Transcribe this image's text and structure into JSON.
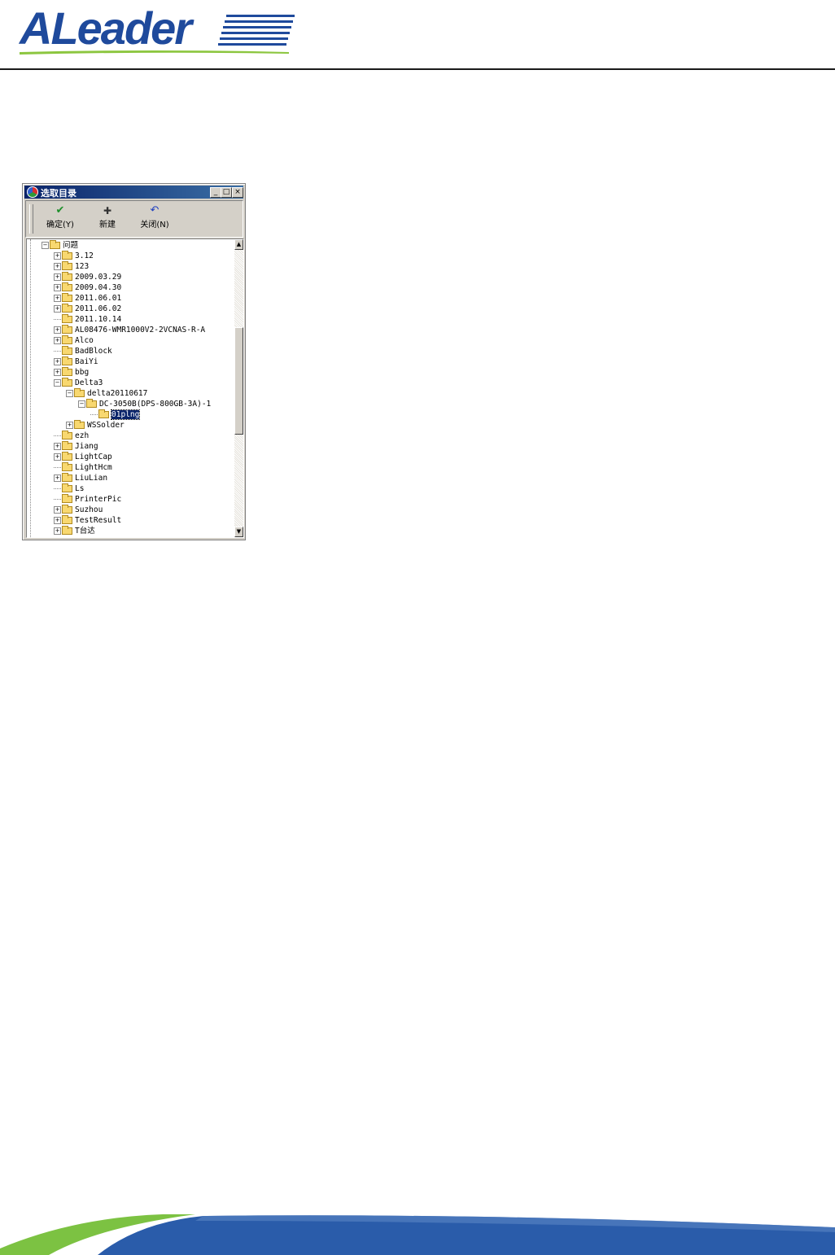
{
  "header": {
    "logo_text": "ALeader",
    "logo_icon": "aleader-logo"
  },
  "dialog": {
    "title": "选取目录",
    "title_icon": "app-icon",
    "window_controls": {
      "minimize": "_",
      "maximize": "□",
      "close": "×"
    },
    "toolbar": {
      "ok_label": "确定(Y)",
      "ok_icon": "checkmark-icon",
      "new_label": "新建",
      "new_icon": "plus-icon",
      "close_label": "关闭(N)",
      "close_icon": "undo-icon"
    },
    "tree": {
      "nodes": [
        {
          "label": "问题",
          "depth": 0,
          "expander": "-"
        },
        {
          "label": "3.12",
          "depth": 1,
          "expander": "+"
        },
        {
          "label": "123",
          "depth": 1,
          "expander": "+"
        },
        {
          "label": "2009.03.29",
          "depth": 1,
          "expander": "+"
        },
        {
          "label": "2009.04.30",
          "depth": 1,
          "expander": "+"
        },
        {
          "label": "2011.06.01",
          "depth": 1,
          "expander": "+"
        },
        {
          "label": "2011.06.02",
          "depth": 1,
          "expander": "+"
        },
        {
          "label": "2011.10.14",
          "depth": 1,
          "expander": ""
        },
        {
          "label": "AL08476-WMR1000V2-2VCNAS-R-A",
          "depth": 1,
          "expander": "+"
        },
        {
          "label": "Alco",
          "depth": 1,
          "expander": "+"
        },
        {
          "label": "BadBlock",
          "depth": 1,
          "expander": ""
        },
        {
          "label": "BaiYi",
          "depth": 1,
          "expander": "+"
        },
        {
          "label": "bbg",
          "depth": 1,
          "expander": "+"
        },
        {
          "label": "Delta3",
          "depth": 1,
          "expander": "-"
        },
        {
          "label": "delta20110617",
          "depth": 2,
          "expander": "-"
        },
        {
          "label": "DC-3050B(DPS-800GB-3A)-1",
          "depth": 3,
          "expander": "-"
        },
        {
          "label": "01plng",
          "depth": 4,
          "expander": "",
          "selected": true
        },
        {
          "label": "WSSolder",
          "depth": 2,
          "expander": "+"
        },
        {
          "label": "ezh",
          "depth": 1,
          "expander": ""
        },
        {
          "label": "Jiang",
          "depth": 1,
          "expander": "+"
        },
        {
          "label": "LightCap",
          "depth": 1,
          "expander": "+"
        },
        {
          "label": "LightHcm",
          "depth": 1,
          "expander": ""
        },
        {
          "label": "LiuLian",
          "depth": 1,
          "expander": "+"
        },
        {
          "label": "Ls",
          "depth": 1,
          "expander": ""
        },
        {
          "label": "PrinterPic",
          "depth": 1,
          "expander": ""
        },
        {
          "label": "Suzhou",
          "depth": 1,
          "expander": "+"
        },
        {
          "label": "TestResult",
          "depth": 1,
          "expander": "+"
        },
        {
          "label": "T台达",
          "depth": 1,
          "expander": "+"
        }
      ]
    },
    "scrollbar": {
      "position_fraction": 0.3
    }
  },
  "colors": {
    "logo_blue": "#1f4a9c",
    "logo_green": "#8cc63f",
    "titlebar": "#0a246a",
    "selection": "#0a246a",
    "footer_green": "#7cc242",
    "footer_blue": "#2a5caa"
  }
}
